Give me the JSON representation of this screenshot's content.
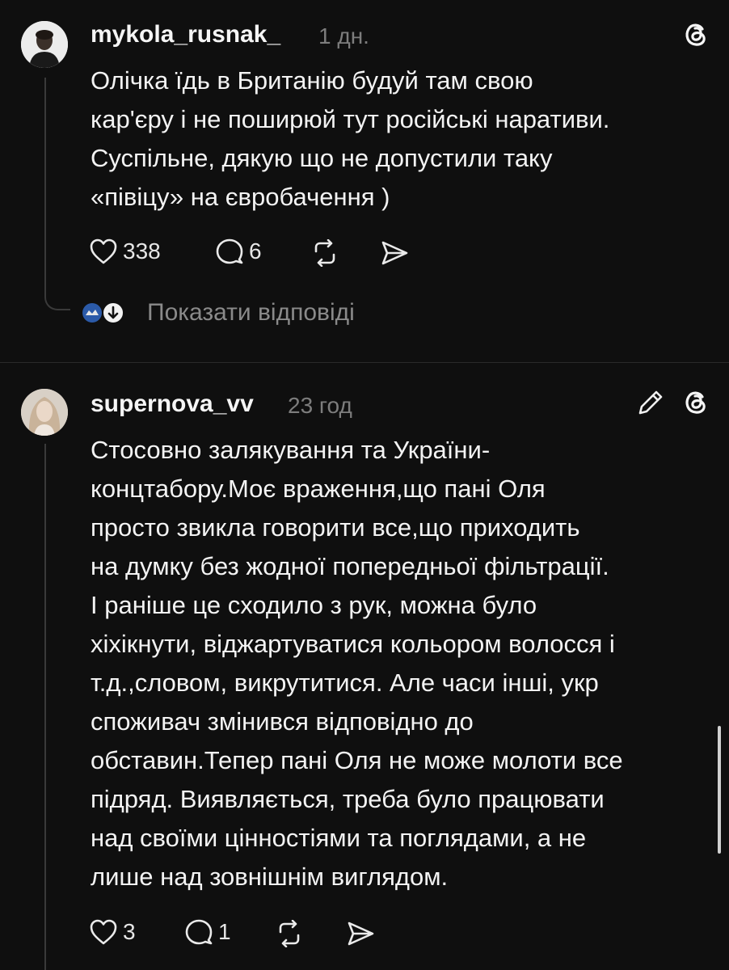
{
  "posts": [
    {
      "username": "mykola_rusnak_",
      "time": "1 дн.",
      "text": "Олічка їдь в Британію будуй там свою\nкар'єру і не поширюй тут російські наративи.\nСуспільне, дякую що не допустили таку\n«півіцу» на євробачення )",
      "likes": "338",
      "replies": "6",
      "show_replies_label": "Показати відповіді",
      "header_icon": "threads-icon"
    },
    {
      "username": "supernova_vv",
      "time": "23 год",
      "text": "Стосовно залякування та України-\nконцтабору.Моє враження,що пані Оля\nпросто звикла говорити все,що приходить\nна думку без жодної попередньої фільтрації.\nІ раніше це сходило з рук, можна було\nхіхікнути, віджартуватися кольором волосся і\nт.д.,словом, викрутитися. Але часи інші, укр\nспоживач змінився відповідно до\nобставин.Тепер пані Оля не може молоти все\nпідряд. Виявляється, треба було працювати\nнад своїми цінностіями та поглядами, а не\nлише над зовнішнім виглядом.",
      "likes": "3",
      "replies": "1",
      "header_icons": [
        "edit-pencil-icon",
        "threads-icon"
      ]
    }
  ],
  "colors": {
    "background": "#0f0f0f",
    "text": "#f3f3f3",
    "muted": "#7d7d7d",
    "divider": "#2a2a2a"
  }
}
